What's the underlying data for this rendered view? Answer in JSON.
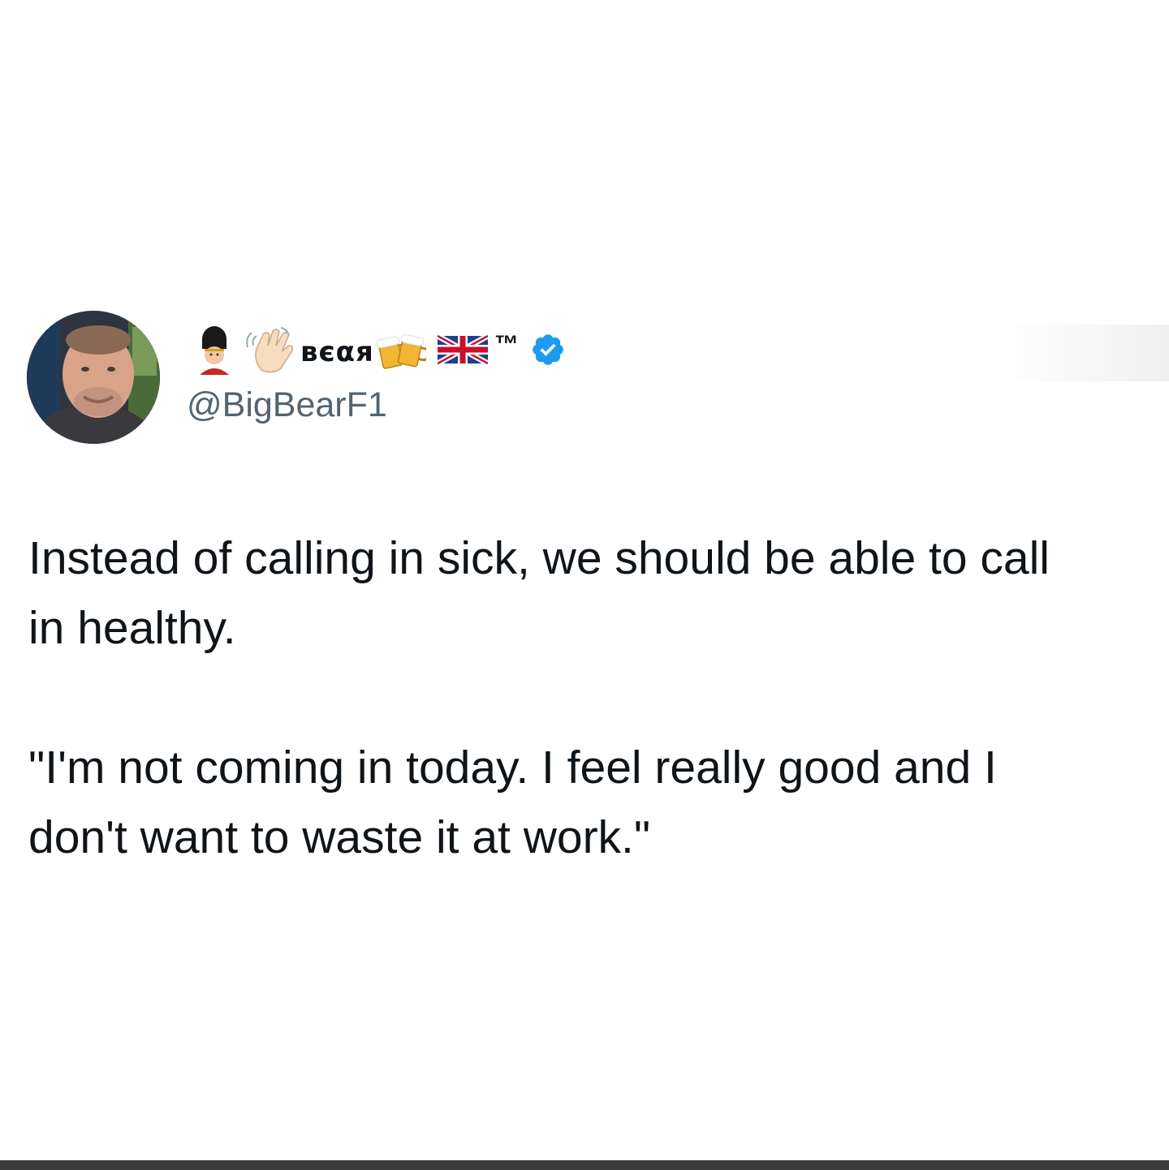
{
  "tweet": {
    "author": {
      "display_name": "вєαя",
      "name_suffix": "™",
      "handle": "@BigBearF1",
      "verified": true,
      "emojis": [
        "guard-emoji",
        "waving-hand-emoji",
        "beer-mugs-emoji",
        "uk-flag-emoji"
      ]
    },
    "text_paragraphs": [
      "Instead of calling in sick, we should be able to call in healthy.",
      "\"I'm not coming in today. I feel really good and I don't want to waste it at work.\""
    ]
  },
  "colors": {
    "text_primary": "#0f1419",
    "text_secondary": "#536471",
    "verified_blue": "#1d9bf0",
    "background": "#ffffff"
  }
}
